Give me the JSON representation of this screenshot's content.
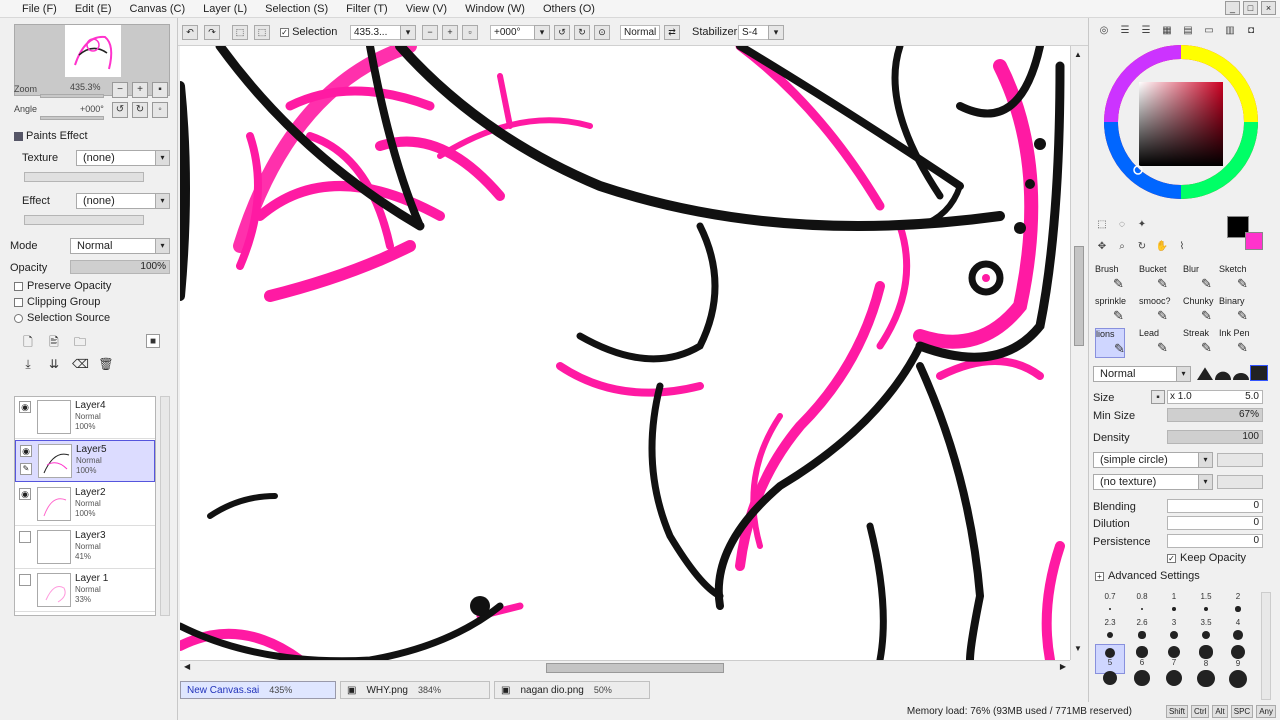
{
  "menu": [
    "File (F)",
    "Edit (E)",
    "Canvas (C)",
    "Layer (L)",
    "Selection (S)",
    "Filter (T)",
    "View (V)",
    "Window (W)",
    "Others (O)"
  ],
  "window_buttons": [
    "_",
    "□",
    "×"
  ],
  "navigator": {
    "zoom_label": "Zoom",
    "zoom_value": "435.3%",
    "angle_label": "Angle",
    "angle_value": "+000°"
  },
  "paints_effect": {
    "title": "Paints Effect",
    "texture_label": "Texture",
    "texture_value": "(none)",
    "effect_label": "Effect",
    "effect_value": "(none)"
  },
  "layer_props": {
    "mode_label": "Mode",
    "mode_value": "Normal",
    "opacity_label": "Opacity",
    "opacity_value": "100%",
    "preserve_opacity": "Preserve Opacity",
    "clipping_group": "Clipping Group",
    "selection_source": "Selection Source"
  },
  "layers": [
    {
      "name": "Layer4",
      "mode": "Normal",
      "opacity": "100%",
      "visible": true,
      "selected": false
    },
    {
      "name": "Layer5",
      "mode": "Normal",
      "opacity": "100%",
      "visible": true,
      "selected": true
    },
    {
      "name": "Layer2",
      "mode": "Normal",
      "opacity": "100%",
      "visible": true,
      "selected": false
    },
    {
      "name": "Layer3",
      "mode": "Normal",
      "opacity": "41%",
      "visible": false,
      "selected": false
    },
    {
      "name": "Layer 1",
      "mode": "Normal",
      "opacity": "33%",
      "visible": false,
      "selected": false
    }
  ],
  "toolbar": {
    "selection_label": "Selection",
    "selection_value": "435.3...",
    "rotation_value": "+000°",
    "blend_mode": "Normal",
    "stabilizer_label": "Stabilizer",
    "stabilizer_value": "S-4"
  },
  "tabs": [
    {
      "name": "New Canvas.sai",
      "zoom": "435%",
      "active": true
    },
    {
      "name": "WHY.png",
      "zoom": "384%",
      "active": false
    },
    {
      "name": "nagan dio.png",
      "zoom": "50%",
      "active": false
    }
  ],
  "status": {
    "memory": "Memory load: 76% (93MB used / 771MB reserved)",
    "keys": [
      "Shift",
      "Ctrl",
      "Alt",
      "SPC",
      "Any"
    ]
  },
  "colors": {
    "primary": "#000000",
    "secondary": "#ff33cc",
    "accent": "#ff1aa3",
    "selection_bg": "#dcdcff"
  },
  "tools": [
    {
      "label": "Brush"
    },
    {
      "label": "Bucket"
    },
    {
      "label": "Blur"
    },
    {
      "label": "Sketch"
    },
    {
      "label": "sprinkle"
    },
    {
      "label": "smooc?"
    },
    {
      "label": "Chunky"
    },
    {
      "label": "Binary"
    },
    {
      "label": "lions"
    },
    {
      "label": "Lead"
    },
    {
      "label": "Streak"
    },
    {
      "label": "Ink Pen"
    }
  ],
  "brush_settings": {
    "blend_mode": "Normal",
    "size_label": "Size",
    "size_mult": "x 1.0",
    "size_value": "5.0",
    "min_size_label": "Min Size",
    "min_size_value": "67%",
    "density_label": "Density",
    "density_value": "100",
    "shape": "(simple circle)",
    "texture": "(no texture)",
    "blending_label": "Blending",
    "blending_value": "0",
    "dilution_label": "Dilution",
    "dilution_value": "0",
    "persistence_label": "Persistence",
    "persistence_value": "0",
    "keep_opacity": "Keep Opacity",
    "advanced": "Advanced Settings"
  },
  "brush_sizes": [
    "0.7",
    "0.8",
    "1",
    "1.5",
    "2",
    "2.3",
    "2.6",
    "3",
    "3.5",
    "4",
    "5",
    "6",
    "7",
    "8",
    "9",
    "",
    "",
    "",
    "",
    ""
  ]
}
